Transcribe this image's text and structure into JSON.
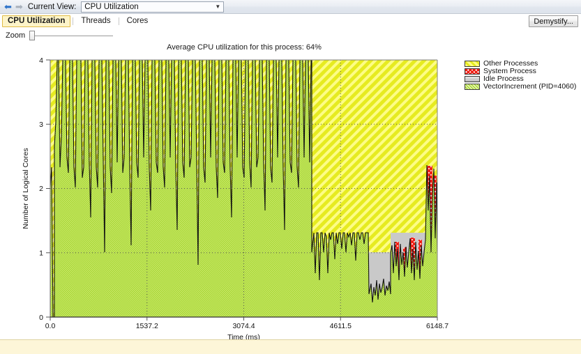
{
  "toolbar": {
    "back_icon": "arrow-left-icon",
    "forward_icon": "arrow-right-icon",
    "current_view_label": "Current View:",
    "current_view_value": "CPU Utilization",
    "dropdown_arrow": "▼"
  },
  "tabs": [
    {
      "label": "CPU Utilization",
      "active": true
    },
    {
      "label": "Threads",
      "active": false
    },
    {
      "label": "Cores",
      "active": false
    }
  ],
  "buttons": {
    "demystify": "Demystify..."
  },
  "zoom": {
    "label": "Zoom",
    "value": 0
  },
  "chart_data": {
    "type": "area",
    "title": "Average CPU utilization for this process: 64%",
    "xlabel": "Time (ms)",
    "ylabel": "Number of Logical Cores",
    "xlim": [
      0.0,
      6148.7
    ],
    "ylim": [
      0,
      4
    ],
    "xticks": [
      "0.0",
      "1537.2",
      "3074.4",
      "4611.5",
      "6148.7"
    ],
    "xtick_values": [
      0.0,
      1537.2,
      3074.4,
      4611.5,
      6148.7
    ],
    "yticks": [
      "0",
      "1",
      "2",
      "3",
      "4"
    ],
    "ytick_values": [
      0,
      1,
      2,
      3,
      4
    ],
    "grid": true,
    "stacked": true,
    "legend_position": "right",
    "series": [
      {
        "name": "Other Processes",
        "color": "#e3e81e",
        "pattern": "diagonal-stripe",
        "legend_order": 1
      },
      {
        "name": "System Process",
        "color": "#ef2a1e",
        "pattern": "cross-hatch",
        "legend_order": 2
      },
      {
        "name": "Idle Process",
        "color": "#c6c6c6",
        "pattern": "solid",
        "legend_order": 3
      },
      {
        "name": "VectorIncrement (PID=4060)",
        "color": "#9acd32",
        "pattern": "fine-hatch",
        "legend_order": 4
      }
    ],
    "annotations": {
      "average_utilization_percent": 64,
      "total_logical_cores": 4,
      "process_name": "VectorIncrement",
      "process_pid": 4060
    }
  },
  "legend": [
    {
      "label": "Other Processes",
      "color": "#e3e81e"
    },
    {
      "label": "System Process",
      "color": "#ef2a1e"
    },
    {
      "label": "Idle Process",
      "color": "#c6c6c6"
    },
    {
      "label": "VectorIncrement (PID=4060)",
      "color": "#9acd32"
    }
  ]
}
